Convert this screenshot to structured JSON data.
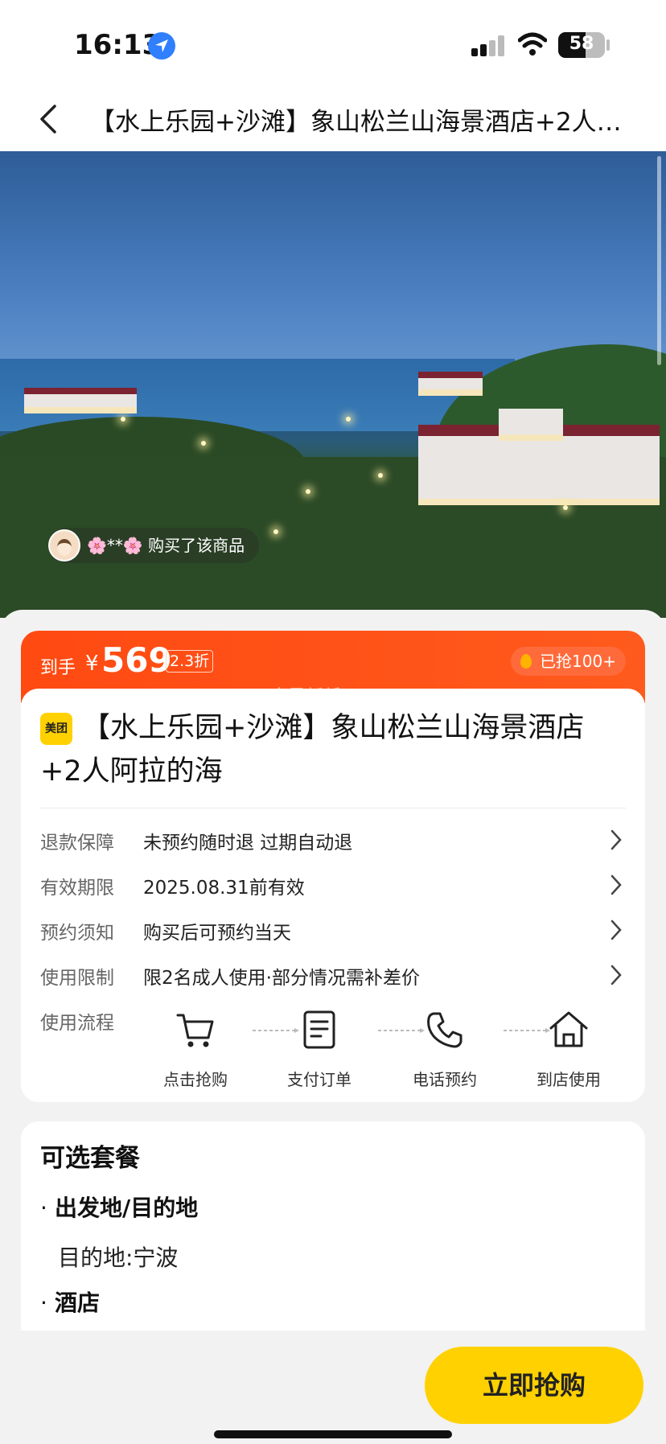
{
  "status_bar": {
    "time": "16:13",
    "battery": "58"
  },
  "header": {
    "title": "【水上乐园+沙滩】象山松兰山海景酒店+2人阿拉的海"
  },
  "hero": {
    "buyer_text": "🌸**🌸 购买了该商品"
  },
  "price": {
    "prefix": "到手",
    "currency": "¥",
    "amount": "569",
    "discount": "2.3折",
    "grabbed": "已抢100+",
    "overlay_text": "全是新低"
  },
  "product": {
    "brand": "美团",
    "title": "【水上乐园+沙滩】象山松兰山海景酒店+2人阿拉的海"
  },
  "info_rows": [
    {
      "label": "退款保障",
      "value": "未预约随时退 过期自动退"
    },
    {
      "label": "有效期限",
      "value": "2025.08.31前有效"
    },
    {
      "label": "预约须知",
      "value": "购买后可预约当天"
    },
    {
      "label": "使用限制",
      "value": "限2名成人使用·部分情况需补差价"
    }
  ],
  "flow": {
    "label": "使用流程",
    "steps": [
      {
        "label": "点击抢购",
        "icon": "cart-icon"
      },
      {
        "label": "支付订单",
        "icon": "document-icon"
      },
      {
        "label": "电话预约",
        "icon": "phone-icon"
      },
      {
        "label": "到店使用",
        "icon": "home-icon"
      }
    ]
  },
  "packages": {
    "title": "可选套餐",
    "sections": [
      {
        "heading": "出发地/目的地",
        "text": "目的地:宁波"
      },
      {
        "heading": "酒店"
      }
    ]
  },
  "bottom": {
    "buy_label": "立即抢购"
  }
}
